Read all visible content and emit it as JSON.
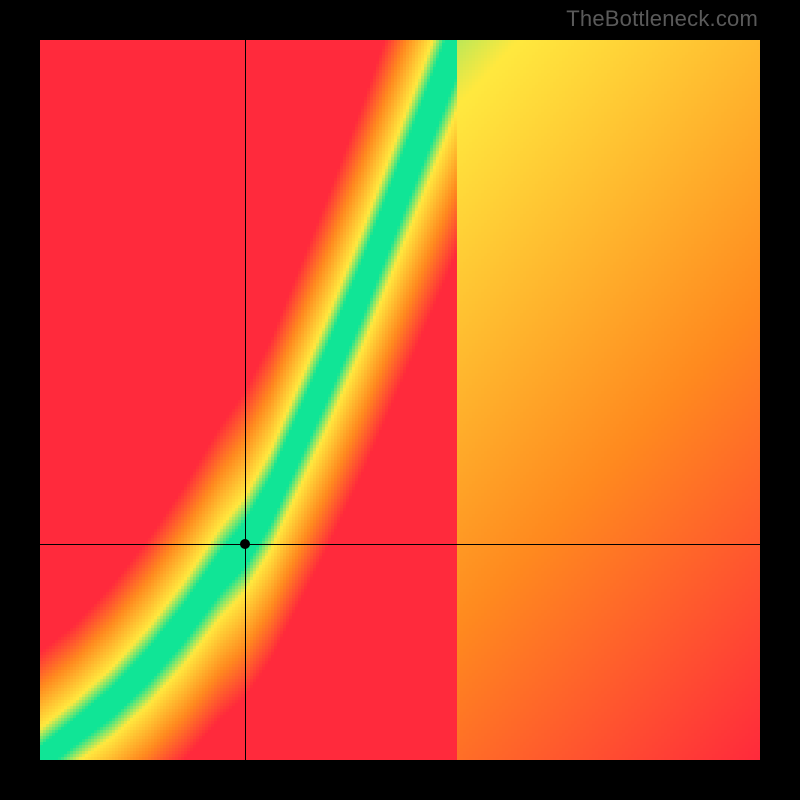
{
  "watermark": "TheBottleneck.com",
  "chart_data": {
    "type": "heatmap",
    "title": "",
    "xlabel": "",
    "ylabel": "",
    "xlim": [
      0,
      1
    ],
    "ylim": [
      0,
      1
    ],
    "grid": false,
    "legend": false,
    "crosshair": {
      "x": 0.285,
      "y": 0.3
    },
    "point": {
      "x": 0.285,
      "y": 0.3
    },
    "ridge_description": "Green optimal ridge rising from the bottom-left corner with an upward-curving knee around (0.28, 0.30), then steep near-linear rise toward the top edge around x ≈ 0.58; broad chart-area gradient red→orange→yellow with thin green band along the ridge.",
    "ridge_samples": [
      {
        "x": 0.0,
        "y": 0.0
      },
      {
        "x": 0.05,
        "y": 0.04
      },
      {
        "x": 0.1,
        "y": 0.08
      },
      {
        "x": 0.15,
        "y": 0.13
      },
      {
        "x": 0.2,
        "y": 0.19
      },
      {
        "x": 0.25,
        "y": 0.26
      },
      {
        "x": 0.285,
        "y": 0.3
      },
      {
        "x": 0.32,
        "y": 0.36
      },
      {
        "x": 0.36,
        "y": 0.45
      },
      {
        "x": 0.4,
        "y": 0.54
      },
      {
        "x": 0.45,
        "y": 0.66
      },
      {
        "x": 0.5,
        "y": 0.79
      },
      {
        "x": 0.55,
        "y": 0.92
      },
      {
        "x": 0.58,
        "y": 1.0
      }
    ],
    "color_stops": {
      "red": "#ff2a3c",
      "orange": "#ff8a1f",
      "yellow": "#ffe93f",
      "green": "#10e596"
    }
  }
}
